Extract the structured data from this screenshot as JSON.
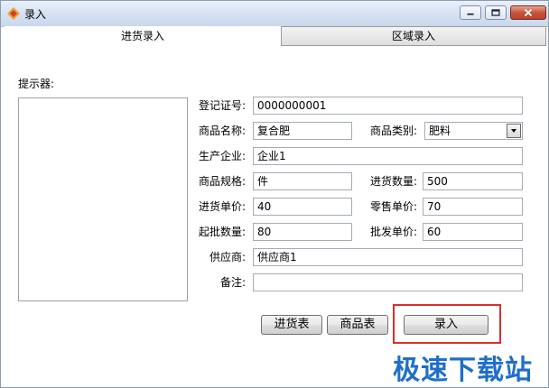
{
  "window": {
    "title": "录入"
  },
  "tabs": [
    {
      "label": "进货录入",
      "active": true
    },
    {
      "label": "区域录入",
      "active": false
    }
  ],
  "hint": {
    "label": "提示器:"
  },
  "form": {
    "reg_no": {
      "label": "登记证号:",
      "value": "0000000001"
    },
    "product_name": {
      "label": "商品名称:",
      "value": "复合肥"
    },
    "category": {
      "label": "商品类别:",
      "value": "肥料"
    },
    "manufacturer": {
      "label": "生产企业:",
      "value": "企业1"
    },
    "spec": {
      "label": "商品规格:",
      "value": "件"
    },
    "purchase_qty": {
      "label": "进货数量:",
      "value": "500"
    },
    "purchase_price": {
      "label": "进货单价:",
      "value": "40"
    },
    "retail_price": {
      "label": "零售单价:",
      "value": "70"
    },
    "min_qty": {
      "label": "起批数量:",
      "value": "80"
    },
    "wholesale_price": {
      "label": "批发单价:",
      "value": "60"
    },
    "supplier": {
      "label": "供应商:",
      "value": "供应商1"
    },
    "remark": {
      "label": "备注:",
      "value": ""
    }
  },
  "buttons": {
    "purchase_table": "进货表",
    "product_table": "商品表",
    "submit": "录入"
  },
  "watermark": "极速下载站",
  "colors": {
    "highlight": "#d9302b",
    "watermark": "#1f6fc9"
  }
}
